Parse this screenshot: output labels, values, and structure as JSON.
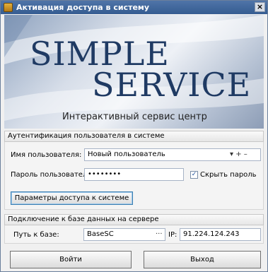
{
  "window": {
    "title": "Активация доступа в систему",
    "close_label": "×"
  },
  "banner": {
    "logo_line1": "SIMPLE",
    "logo_line2": "SERVICE",
    "tagline": "Интерактивный сервис центр"
  },
  "auth": {
    "header": "Аутентификация пользователя в системе",
    "username_label": "Имя пользователя:",
    "username_value": "Новый пользователь",
    "username_controls": "▾  +  –",
    "password_label": "Пароль пользователя:",
    "password_value": "••••••••",
    "hide_password_label": "Скрыть пароль",
    "hide_password_checked": true,
    "access_params_button": "Параметры доступа к системе"
  },
  "connection": {
    "header": "Подключение к базе данных на сервере",
    "path_label": "Путь к базе:",
    "path_value": "BaseSC",
    "browse_label": "···",
    "ip_label": "IP:",
    "ip_value": "91.224.124.243"
  },
  "actions": {
    "login_button": "Войти",
    "exit_button": "Выход"
  }
}
